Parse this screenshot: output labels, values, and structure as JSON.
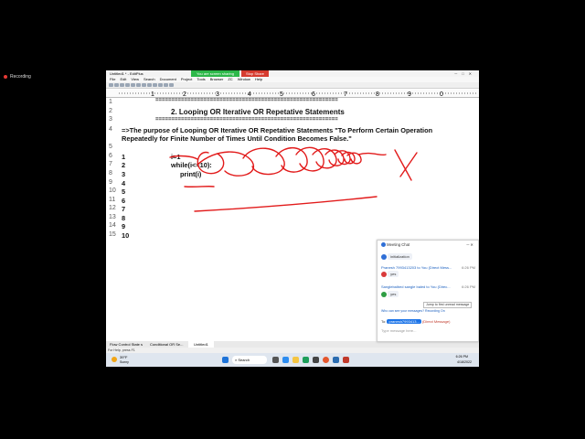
{
  "recording": {
    "label": "Recording"
  },
  "window": {
    "title": "Untitled1 * - EditPlus",
    "sharing_label": "You are screen sharing",
    "stop_share_label": "Stop Share"
  },
  "menu": [
    "File",
    "Edit",
    "View",
    "Search",
    "Document",
    "Project",
    "Tools",
    "Browser",
    "ZC",
    "Window",
    "Help"
  ],
  "ruler": {
    "marks": [
      "1",
      "2",
      "3",
      "4",
      "5",
      "6",
      "7",
      "8",
      "9",
      "0"
    ]
  },
  "editor": {
    "line_numbers": [
      "1",
      "2",
      "3",
      "4",
      "5",
      "6",
      "7",
      "8",
      "9",
      "10",
      "11",
      "12",
      "13",
      "14",
      "15"
    ],
    "lines": {
      "l1": "=========================================================",
      "l2": "2. Looping OR Iterative OR Repetative Statements",
      "l3": "=========================================================",
      "l4a": "=>The purpose of Looping OR Iterative OR Repetative Statements \"To Perform Certain Operation",
      "l4b": "Repeatedly for Finite Number of Times Until Condition Becomes False.\"",
      "l6": "i=1",
      "l7": "while(i<=10):",
      "l8": "print(i)"
    },
    "output": [
      "1",
      "2",
      "3",
      "4",
      "5",
      "6",
      "7",
      "8",
      "9",
      "10"
    ]
  },
  "chat": {
    "title": "Meeting Chat",
    "entries": [
      {
        "text": "initialization"
      },
      {
        "sender": "Pranesh 7993413203 to You (Direct Mess...",
        "time": "6:26 PM",
        "text": "yes"
      },
      {
        "sender": "Sanglebalbed sangle baled to You (Direc...",
        "time": "6:26 PM",
        "text": "yes"
      }
    ],
    "jump_label": "Jump to first unread message",
    "notice": "Who can see your messages? Recording On",
    "to_label": "To:",
    "to_recipient": "pranesh7993413...",
    "to_suffix": "(Direct Message)",
    "placeholder": "Type message here...",
    "colors": {
      "avatar_blue": "#2f6fd6",
      "avatar_red": "#d93a3a",
      "avatar_green": "#2f9e44"
    }
  },
  "tabs": {
    "tab1": "Flow Control State s",
    "tab2": "Conditional OR Se...",
    "tab3": "Untitled1"
  },
  "status": {
    "help": "For Help, press F1"
  },
  "taskbar": {
    "weather_temp": "39°F",
    "weather_desc": "Sunny",
    "search": "Search",
    "time": "6:26 PM",
    "date": "4/18/2022"
  },
  "ink_color": "#e21b1b"
}
